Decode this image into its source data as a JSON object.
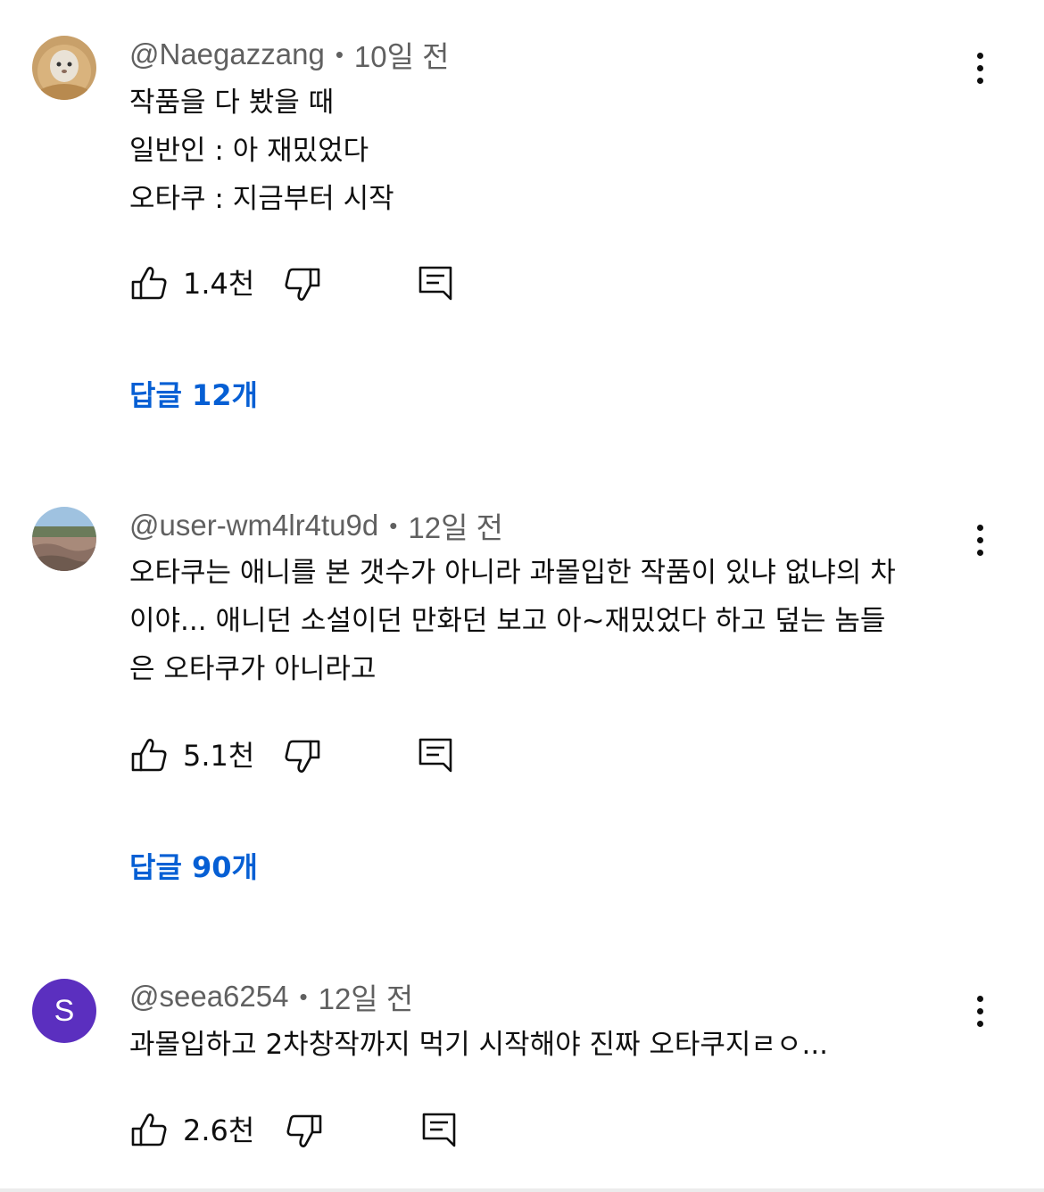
{
  "comments": [
    {
      "author": "@Naegazzang",
      "time": "10일 전",
      "lines": [
        "작품을 다 봤을 때",
        "일반인 : 아 재밌었다",
        "오타쿠 : 지금부터 시작"
      ],
      "likes": "1.4천",
      "replies": "답글 12개",
      "avatar": "avatar-photo-cat"
    },
    {
      "author": "@user-wm4lr4tu9d",
      "time": "12일 전",
      "lines": [
        "오타쿠는 애니를 본 갯수가 아니라 과몰입한 작품이 있냐 없냐의 차",
        "이야... 애니던 소설이던 만화던 보고 아~재밌었다 하고 덮는 놈들",
        "은 오타쿠가 아니라고"
      ],
      "likes": "5.1천",
      "replies": "답글 90개",
      "avatar": "avatar-photo-landscape"
    },
    {
      "author": "@seea6254",
      "time": "12일 전",
      "lines": [
        "과몰입하고 2차창작까지 먹기 시작해야 진짜 오타쿠지ㄹㅇ..."
      ],
      "likes": "2.6천",
      "avatar_letter": "S",
      "avatar_color": "#5b2fbf"
    }
  ],
  "separator": "•",
  "colors": {
    "link": "#065fd4",
    "meta": "#606060",
    "text": "#0f0f0f"
  },
  "icons": [
    "like-icon",
    "dislike-icon",
    "reply-icon",
    "more-vert-icon"
  ]
}
